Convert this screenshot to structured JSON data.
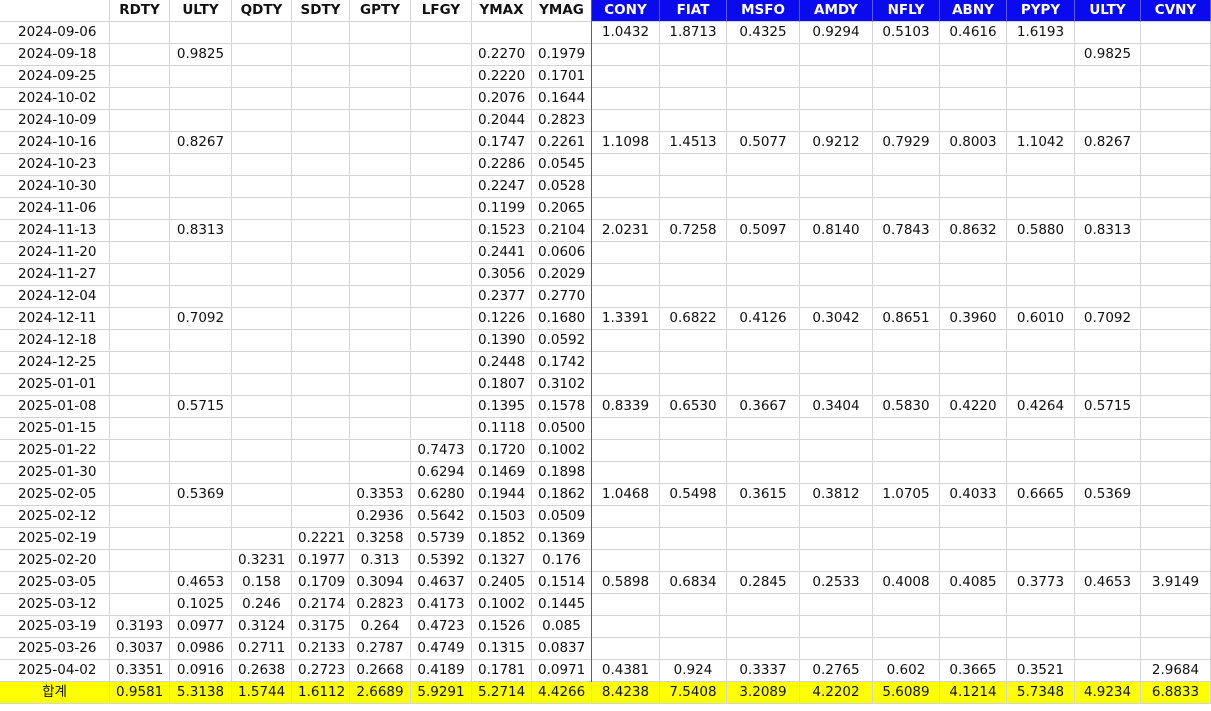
{
  "headers": [
    "",
    "RDTY",
    "ULTY",
    "QDTY",
    "SDTY",
    "GPTY",
    "LFGY",
    "YMAX",
    "YMAG",
    "CONY",
    "FIAT",
    "MSFO",
    "AMDY",
    "NFLY",
    "ABNY",
    "PYPY",
    "ULTY",
    "CVNY"
  ],
  "blue_header_from": 9,
  "header_blue_color": "#0A0AF0",
  "total_row_color": "#FFFF00",
  "rows": [
    [
      "2024-09-06",
      "",
      "",
      "",
      "",
      "",
      "",
      "",
      "",
      "1.0432",
      "1.8713",
      "0.4325",
      "0.9294",
      "0.5103",
      "0.4616",
      "1.6193",
      "",
      ""
    ],
    [
      "2024-09-18",
      "",
      "0.9825",
      "",
      "",
      "",
      "",
      "0.2270",
      "0.1979",
      "",
      "",
      "",
      "",
      "",
      "",
      "",
      "0.9825",
      ""
    ],
    [
      "2024-09-25",
      "",
      "",
      "",
      "",
      "",
      "",
      "0.2220",
      "0.1701",
      "",
      "",
      "",
      "",
      "",
      "",
      "",
      "",
      ""
    ],
    [
      "2024-10-02",
      "",
      "",
      "",
      "",
      "",
      "",
      "0.2076",
      "0.1644",
      "",
      "",
      "",
      "",
      "",
      "",
      "",
      "",
      ""
    ],
    [
      "2024-10-09",
      "",
      "",
      "",
      "",
      "",
      "",
      "0.2044",
      "0.2823",
      "",
      "",
      "",
      "",
      "",
      "",
      "",
      "",
      ""
    ],
    [
      "2024-10-16",
      "",
      "0.8267",
      "",
      "",
      "",
      "",
      "0.1747",
      "0.2261",
      "1.1098",
      "1.4513",
      "0.5077",
      "0.9212",
      "0.7929",
      "0.8003",
      "1.1042",
      "0.8267",
      ""
    ],
    [
      "2024-10-23",
      "",
      "",
      "",
      "",
      "",
      "",
      "0.2286",
      "0.0545",
      "",
      "",
      "",
      "",
      "",
      "",
      "",
      "",
      ""
    ],
    [
      "2024-10-30",
      "",
      "",
      "",
      "",
      "",
      "",
      "0.2247",
      "0.0528",
      "",
      "",
      "",
      "",
      "",
      "",
      "",
      "",
      ""
    ],
    [
      "2024-11-06",
      "",
      "",
      "",
      "",
      "",
      "",
      "0.1199",
      "0.2065",
      "",
      "",
      "",
      "",
      "",
      "",
      "",
      "",
      ""
    ],
    [
      "2024-11-13",
      "",
      "0.8313",
      "",
      "",
      "",
      "",
      "0.1523",
      "0.2104",
      "2.0231",
      "0.7258",
      "0.5097",
      "0.8140",
      "0.7843",
      "0.8632",
      "0.5880",
      "0.8313",
      ""
    ],
    [
      "2024-11-20",
      "",
      "",
      "",
      "",
      "",
      "",
      "0.2441",
      "0.0606",
      "",
      "",
      "",
      "",
      "",
      "",
      "",
      "",
      ""
    ],
    [
      "2024-11-27",
      "",
      "",
      "",
      "",
      "",
      "",
      "0.3056",
      "0.2029",
      "",
      "",
      "",
      "",
      "",
      "",
      "",
      "",
      ""
    ],
    [
      "2024-12-04",
      "",
      "",
      "",
      "",
      "",
      "",
      "0.2377",
      "0.2770",
      "",
      "",
      "",
      "",
      "",
      "",
      "",
      "",
      ""
    ],
    [
      "2024-12-11",
      "",
      "0.7092",
      "",
      "",
      "",
      "",
      "0.1226",
      "0.1680",
      "1.3391",
      "0.6822",
      "0.4126",
      "0.3042",
      "0.8651",
      "0.3960",
      "0.6010",
      "0.7092",
      ""
    ],
    [
      "2024-12-18",
      "",
      "",
      "",
      "",
      "",
      "",
      "0.1390",
      "0.0592",
      "",
      "",
      "",
      "",
      "",
      "",
      "",
      "",
      ""
    ],
    [
      "2024-12-25",
      "",
      "",
      "",
      "",
      "",
      "",
      "0.2448",
      "0.1742",
      "",
      "",
      "",
      "",
      "",
      "",
      "",
      "",
      ""
    ],
    [
      "2025-01-01",
      "",
      "",
      "",
      "",
      "",
      "",
      "0.1807",
      "0.3102",
      "",
      "",
      "",
      "",
      "",
      "",
      "",
      "",
      ""
    ],
    [
      "2025-01-08",
      "",
      "0.5715",
      "",
      "",
      "",
      "",
      "0.1395",
      "0.1578",
      "0.8339",
      "0.6530",
      "0.3667",
      "0.3404",
      "0.5830",
      "0.4220",
      "0.4264",
      "0.5715",
      ""
    ],
    [
      "2025-01-15",
      "",
      "",
      "",
      "",
      "",
      "",
      "0.1118",
      "0.0500",
      "",
      "",
      "",
      "",
      "",
      "",
      "",
      "",
      ""
    ],
    [
      "2025-01-22",
      "",
      "",
      "",
      "",
      "",
      "0.7473",
      "0.1720",
      "0.1002",
      "",
      "",
      "",
      "",
      "",
      "",
      "",
      "",
      ""
    ],
    [
      "2025-01-30",
      "",
      "",
      "",
      "",
      "",
      "0.6294",
      "0.1469",
      "0.1898",
      "",
      "",
      "",
      "",
      "",
      "",
      "",
      "",
      ""
    ],
    [
      "2025-02-05",
      "",
      "0.5369",
      "",
      "",
      "0.3353",
      "0.6280",
      "0.1944",
      "0.1862",
      "1.0468",
      "0.5498",
      "0.3615",
      "0.3812",
      "1.0705",
      "0.4033",
      "0.6665",
      "0.5369",
      ""
    ],
    [
      "2025-02-12",
      "",
      "",
      "",
      "",
      "0.2936",
      "0.5642",
      "0.1503",
      "0.0509",
      "",
      "",
      "",
      "",
      "",
      "",
      "",
      "",
      ""
    ],
    [
      "2025-02-19",
      "",
      "",
      "",
      "0.2221",
      "0.3258",
      "0.5739",
      "0.1852",
      "0.1369",
      "",
      "",
      "",
      "",
      "",
      "",
      "",
      "",
      ""
    ],
    [
      "2025-02-20",
      "",
      "",
      "0.3231",
      "0.1977",
      "0.313",
      "0.5392",
      "0.1327",
      "0.176",
      "",
      "",
      "",
      "",
      "",
      "",
      "",
      "",
      ""
    ],
    [
      "2025-03-05",
      "",
      "0.4653",
      "0.158",
      "0.1709",
      "0.3094",
      "0.4637",
      "0.2405",
      "0.1514",
      "0.5898",
      "0.6834",
      "0.2845",
      "0.2533",
      "0.4008",
      "0.4085",
      "0.3773",
      "0.4653",
      "3.9149"
    ],
    [
      "2025-03-12",
      "",
      "0.1025",
      "0.246",
      "0.2174",
      "0.2823",
      "0.4173",
      "0.1002",
      "0.1445",
      "",
      "",
      "",
      "",
      "",
      "",
      "",
      "",
      ""
    ],
    [
      "2025-03-19",
      "0.3193",
      "0.0977",
      "0.3124",
      "0.3175",
      "0.264",
      "0.4723",
      "0.1526",
      "0.085",
      "",
      "",
      "",
      "",
      "",
      "",
      "",
      "",
      ""
    ],
    [
      "2025-03-26",
      "0.3037",
      "0.0986",
      "0.2711",
      "0.2133",
      "0.2787",
      "0.4749",
      "0.1315",
      "0.0837",
      "",
      "",
      "",
      "",
      "",
      "",
      "",
      "",
      ""
    ],
    [
      "2025-04-02",
      "0.3351",
      "0.0916",
      "0.2638",
      "0.2723",
      "0.2668",
      "0.4189",
      "0.1781",
      "0.0971",
      "0.4381",
      "0.924",
      "0.3337",
      "0.2765",
      "0.602",
      "0.3665",
      "0.3521",
      "",
      "2.9684"
    ]
  ],
  "total": [
    "합계",
    "0.9581",
    "5.3138",
    "1.5744",
    "1.6112",
    "2.6689",
    "5.9291",
    "5.2714",
    "4.4266",
    "8.4238",
    "7.5408",
    "3.2089",
    "4.2202",
    "5.6089",
    "4.1214",
    "5.7348",
    "4.9234",
    "6.8833"
  ]
}
